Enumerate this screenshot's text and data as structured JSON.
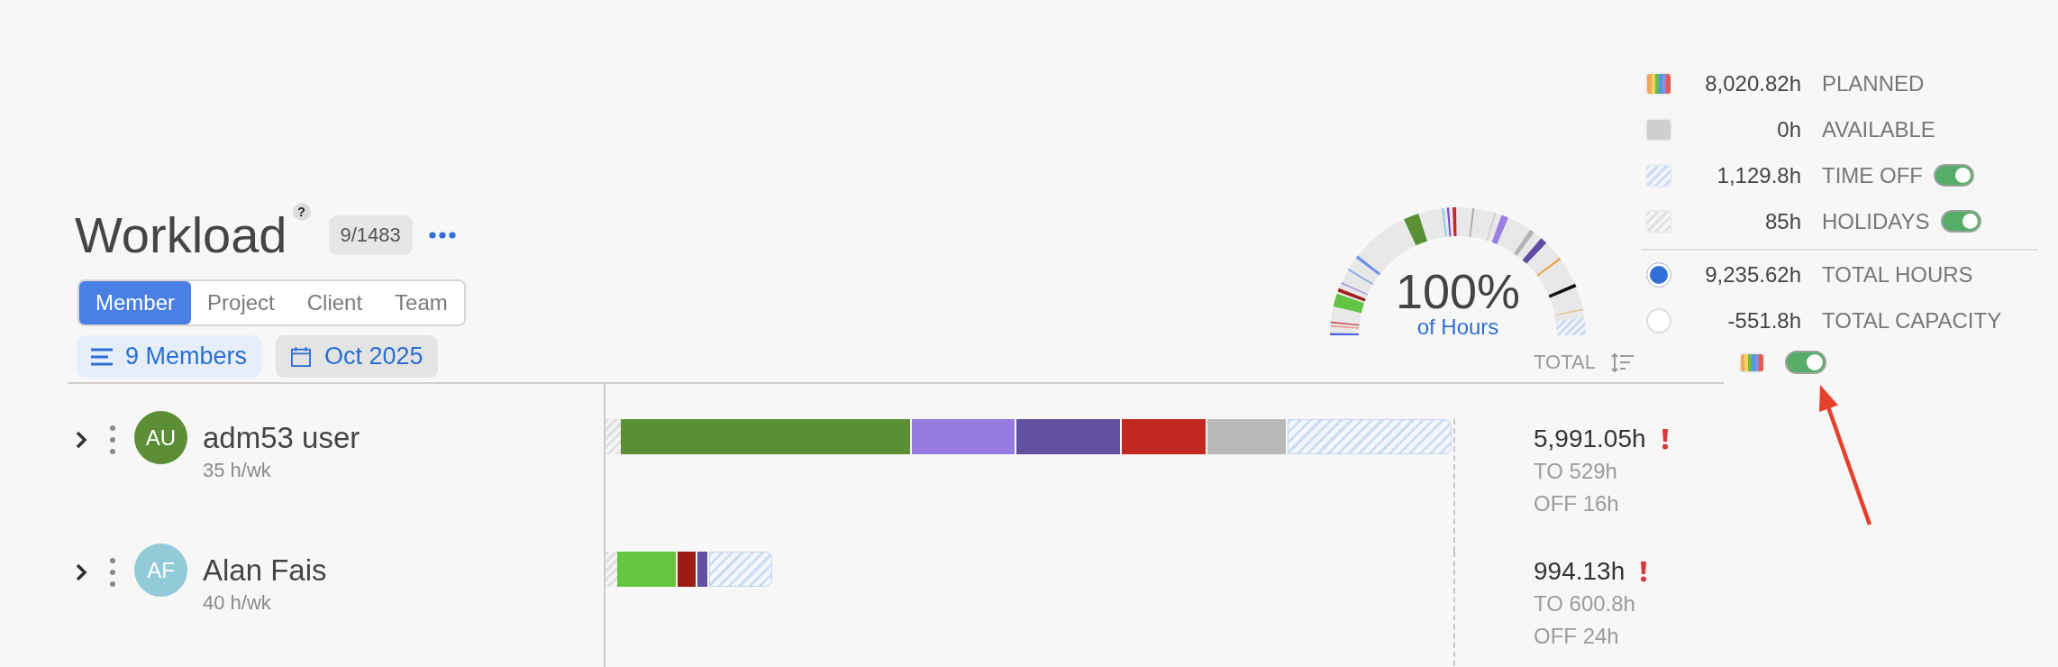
{
  "header": {
    "title": "Workload",
    "help": "?",
    "count": "9/1483",
    "tabs": [
      {
        "label": "Member",
        "selected": true
      },
      {
        "label": "Project",
        "selected": false
      },
      {
        "label": "Client",
        "selected": false
      },
      {
        "label": "Team",
        "selected": false
      }
    ],
    "filters": [
      {
        "kind": "members",
        "label": "9 Members"
      },
      {
        "kind": "month",
        "label": "Oct 2025"
      }
    ]
  },
  "gauge": {
    "value": "100%",
    "caption": "of Hours"
  },
  "total_column": {
    "label": "TOTAL"
  },
  "legend": {
    "items": [
      {
        "kind": "planned",
        "value": "8,020.82h",
        "label": "PLANNED"
      },
      {
        "kind": "available",
        "value": "0h",
        "label": "AVAILABLE"
      },
      {
        "kind": "time_off",
        "value": "1,129.8h",
        "label": "TIME OFF",
        "toggle": {
          "on": true
        }
      },
      {
        "kind": "holidays",
        "value": "85h",
        "label": "HOLIDAYS",
        "toggle": {
          "on": true
        }
      }
    ],
    "totals": [
      {
        "value": "9,235.62h",
        "label": "TOTAL HOURS",
        "selected": true
      },
      {
        "value": "-551.8h",
        "label": "TOTAL CAPACITY",
        "selected": false
      }
    ],
    "project_colors": {
      "on": true
    }
  },
  "rows": [
    {
      "expanded": false,
      "avatar": {
        "initials": "AU",
        "color": "#5b8e37"
      },
      "name": "adm53 user",
      "capacity": "35 h/wk",
      "segments": [
        {
          "kind": "holiday"
        },
        {
          "kind": "project",
          "color": "#5b8f36"
        },
        {
          "kind": "project",
          "color": "#957be0"
        },
        {
          "kind": "project",
          "color": "#6250a2"
        },
        {
          "kind": "project",
          "color": "#c1281f"
        },
        {
          "kind": "project",
          "color": "#b9b8b8"
        },
        {
          "kind": "time_off"
        }
      ],
      "total": {
        "hours": "5,991.05h",
        "alert": true,
        "time_off": "TO 529h",
        "off": "OFF 16h"
      }
    },
    {
      "expanded": false,
      "avatar": {
        "initials": "AF",
        "color": "#92cad8"
      },
      "name": "Alan Fais",
      "capacity": "40 h/wk",
      "segments": [
        {
          "kind": "holiday"
        },
        {
          "kind": "project",
          "color": "#65c541"
        },
        {
          "kind": "project",
          "color": "#9a1c12"
        },
        {
          "kind": "project",
          "color": "#6250a2"
        },
        {
          "kind": "time_off"
        }
      ],
      "total": {
        "hours": "994.13h",
        "alert": true,
        "time_off": "TO 600.8h",
        "off": "OFF 24h"
      }
    }
  ]
}
